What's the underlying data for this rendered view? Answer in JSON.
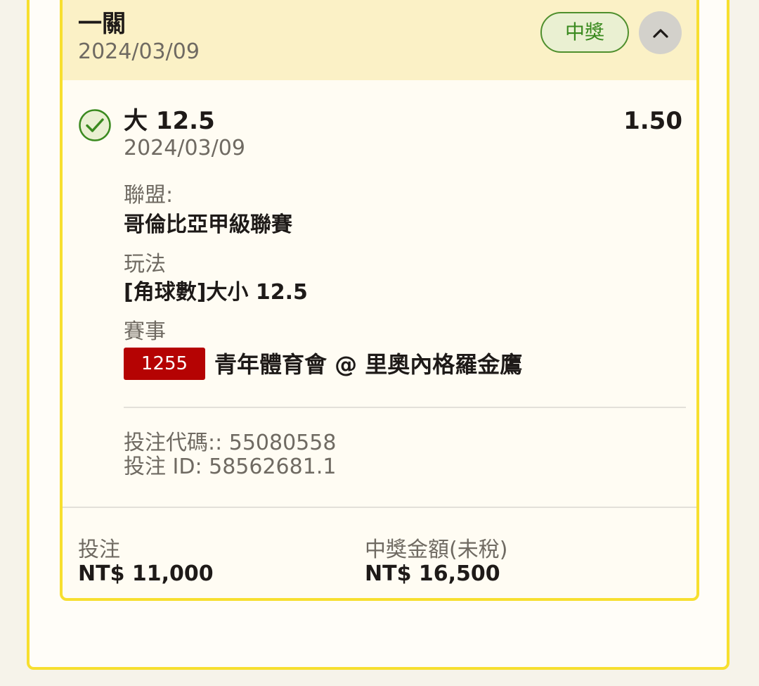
{
  "header": {
    "title": "一關",
    "date": "2024/03/09",
    "status_label": "中獎",
    "collapse_icon": "chevron-up-icon"
  },
  "selection": {
    "status_icon": "check-circle-icon",
    "name": "大 12.5",
    "odds": "1.50",
    "date": "2024/03/09",
    "league_label": "聯盟:",
    "league_value": "哥倫比亞甲級聯賽",
    "market_label": "玩法",
    "market_value": "[角球數]大小 12.5",
    "event_label": "賽事",
    "event_code": "1255",
    "event_name": "青年體育會 @ 里奧內格羅金鷹"
  },
  "refs": {
    "bet_code": "投注代碼:: 55080558",
    "bet_id": "投注 ID: 58562681.1"
  },
  "summary": {
    "stake_label": "投注",
    "stake_value": "NT$ 11,000",
    "payout_label": "中獎金額(未稅)",
    "payout_value": "NT$ 16,500"
  },
  "colors": {
    "card_border": "#f7df2f",
    "header_bg": "#fbf1c6",
    "win_green": "#3a8a1f",
    "event_badge": "#b50303"
  }
}
